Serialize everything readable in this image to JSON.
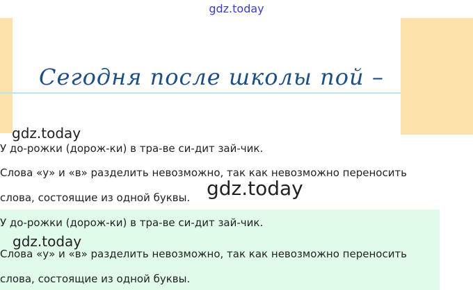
{
  "watermark": {
    "top": "gdz.today",
    "overlay_1": "gdz.today",
    "overlay_2": "gdz.today",
    "overlay_3": "gdz.today"
  },
  "handwriting": {
    "text": "Сегодня после школы пой –"
  },
  "section_1": {
    "line_1": "У до-рожки (дорож-ки) в тра-ве си-дит зай-чик.",
    "line_2": "Слова «у» и «в» разделить невозможно, так как невозможно переносить",
    "line_3": "слова, состоящие из одной буквы."
  },
  "section_2": {
    "line_1": "У до-рожки (дорож-ки) в тра-ве си-дит зай-чик.",
    "line_2": "Слова «у» и «в» разделить невозможно, так как невозможно переносить",
    "line_3": "слова, состоящие из одной буквы."
  },
  "colors": {
    "side_blocks": "#fde2ab",
    "highlight": "#e0fbe9",
    "handwriting": "#1d4e86",
    "watermark_top": "#3a3ad0"
  }
}
